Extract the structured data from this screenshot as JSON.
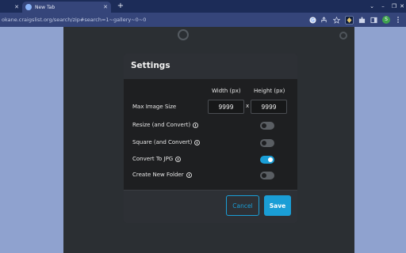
{
  "browser": {
    "tabs": [
      {
        "label": "",
        "active": false
      },
      {
        "label": "New Tab",
        "active": true
      }
    ],
    "url": "okane.craigslist.org/search/zip#search=1~gallery~0~0",
    "profile_initial": "S"
  },
  "settings": {
    "title": "Settings",
    "width_header": "Width (px)",
    "height_header": "Height (px)",
    "max_image_size_label": "Max Image Size",
    "width_value": "9999",
    "height_value": "9999",
    "times_symbol": "x",
    "options": [
      {
        "label": "Resize (and Convert)",
        "on": false
      },
      {
        "label": "Square (and Convert)",
        "on": false
      },
      {
        "label": "Convert To JPG",
        "on": true
      },
      {
        "label": "Create New Folder",
        "on": false
      }
    ],
    "cancel_label": "Cancel",
    "save_label": "Save"
  },
  "colors": {
    "accent": "#1a9ed6",
    "modal_bg": "#1e1f21",
    "header_bg": "#2d3035",
    "page_outer": "#8fa2cf",
    "chrome": "#1c2c58"
  }
}
